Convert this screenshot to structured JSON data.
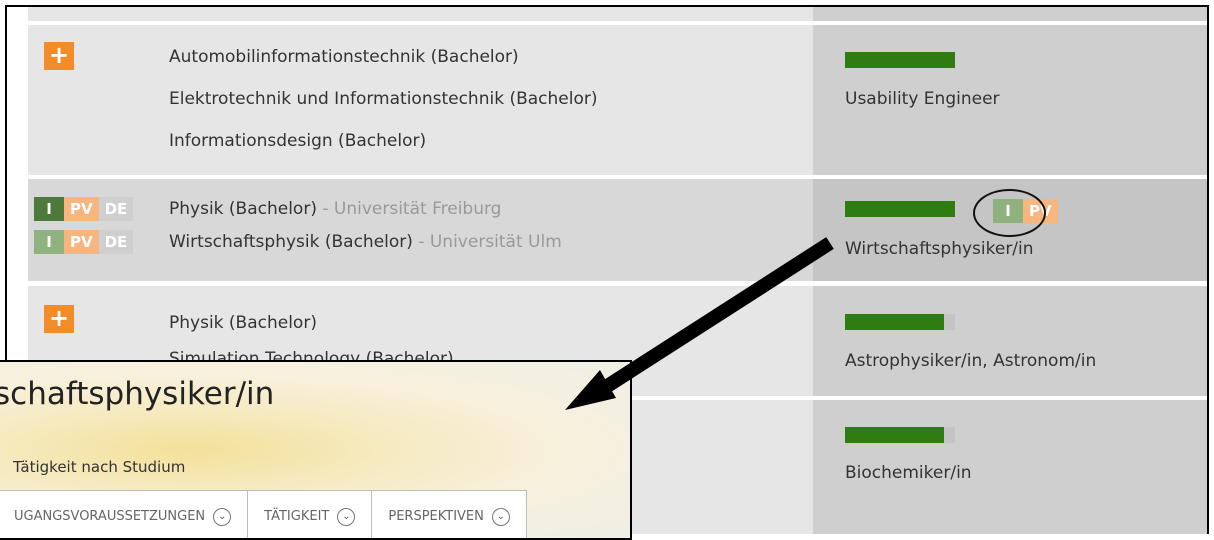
{
  "rows": [
    {
      "courses": [
        {
          "name": "Automobilinformationstechnik (Bachelor)"
        },
        {
          "name": "Elektrotechnik und Informationstechnik (Bachelor)"
        },
        {
          "name": "Informationsdesign (Bachelor)"
        }
      ],
      "career": "Usability Engineer",
      "progress": 1.0
    },
    {
      "courses": [
        {
          "name": "Physik (Bachelor)",
          "uni": "- Universität Freiburg"
        },
        {
          "name": "Wirtschaftsphysik (Bachelor)",
          "uni": "- Universität Ulm"
        }
      ],
      "badge_labels": {
        "i": "I",
        "pv": "PV",
        "de": "DE"
      },
      "career": "Wirtschaftsphysiker/in",
      "progress": 1.0
    },
    {
      "courses": [
        {
          "name": "Physik (Bachelor)"
        },
        {
          "name": "Simulation Technology (Bachelor)"
        }
      ],
      "career": "Astrophysiker/in, Astronom/in",
      "progress": 0.9
    },
    {
      "career": "Biochemiker/in",
      "progress": 0.9
    }
  ],
  "popup": {
    "title": "schaftsphysiker/in",
    "subtitle": "Tätigkeit nach Studium",
    "tabs": [
      "UGANGSVORAUSSETZUNGEN",
      "TÄTIGKEIT",
      "PERSPEKTIVEN"
    ]
  },
  "colors": {
    "accent": "#f28c28",
    "progress": "#2f7c11"
  }
}
